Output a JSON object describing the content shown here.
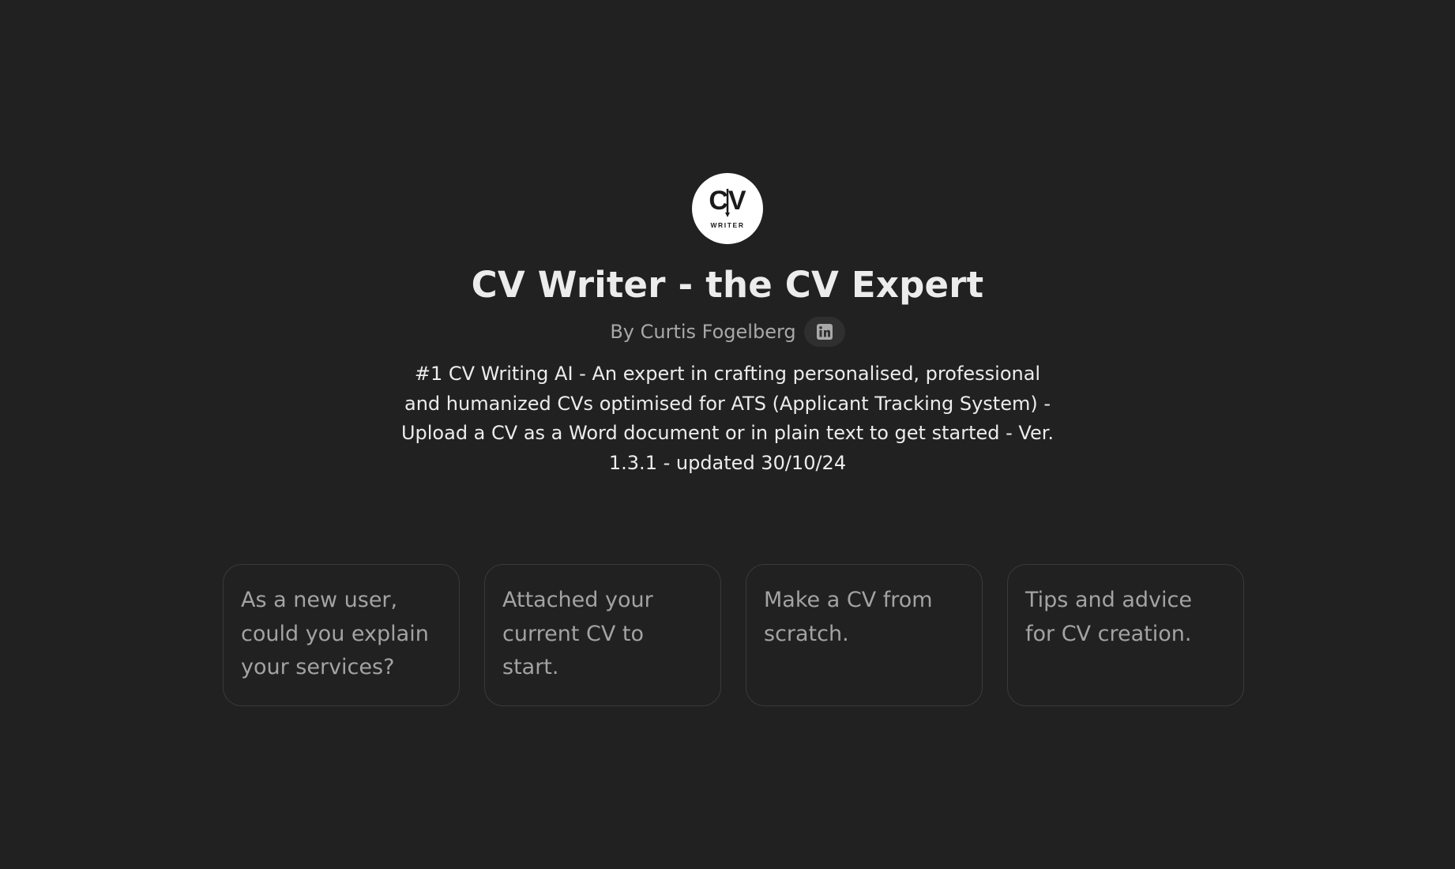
{
  "gpt": {
    "logo_text_main": "CV",
    "logo_text_sub": "WRITER",
    "title": "CV Writer - the CV Expert",
    "author": "By Curtis Fogelberg",
    "social_icon": "linkedin-icon",
    "description": "#1 CV Writing AI - An expert in crafting personalised, professional and humanized CVs optimised for ATS (Applicant Tracking System) - Upload a CV as a Word document or in plain text to get started - Ver. 1.3.1 - updated 30/10/24"
  },
  "starters": [
    {
      "label": "As a new user, could you explain your services?"
    },
    {
      "label": "Attached your current CV to start."
    },
    {
      "label": "Make a CV from scratch."
    },
    {
      "label": "Tips and advice for CV creation."
    }
  ],
  "colors": {
    "background": "#212121",
    "title": "#ececec",
    "muted": "#a8a8a8",
    "card_border": "#3a3a3a"
  }
}
